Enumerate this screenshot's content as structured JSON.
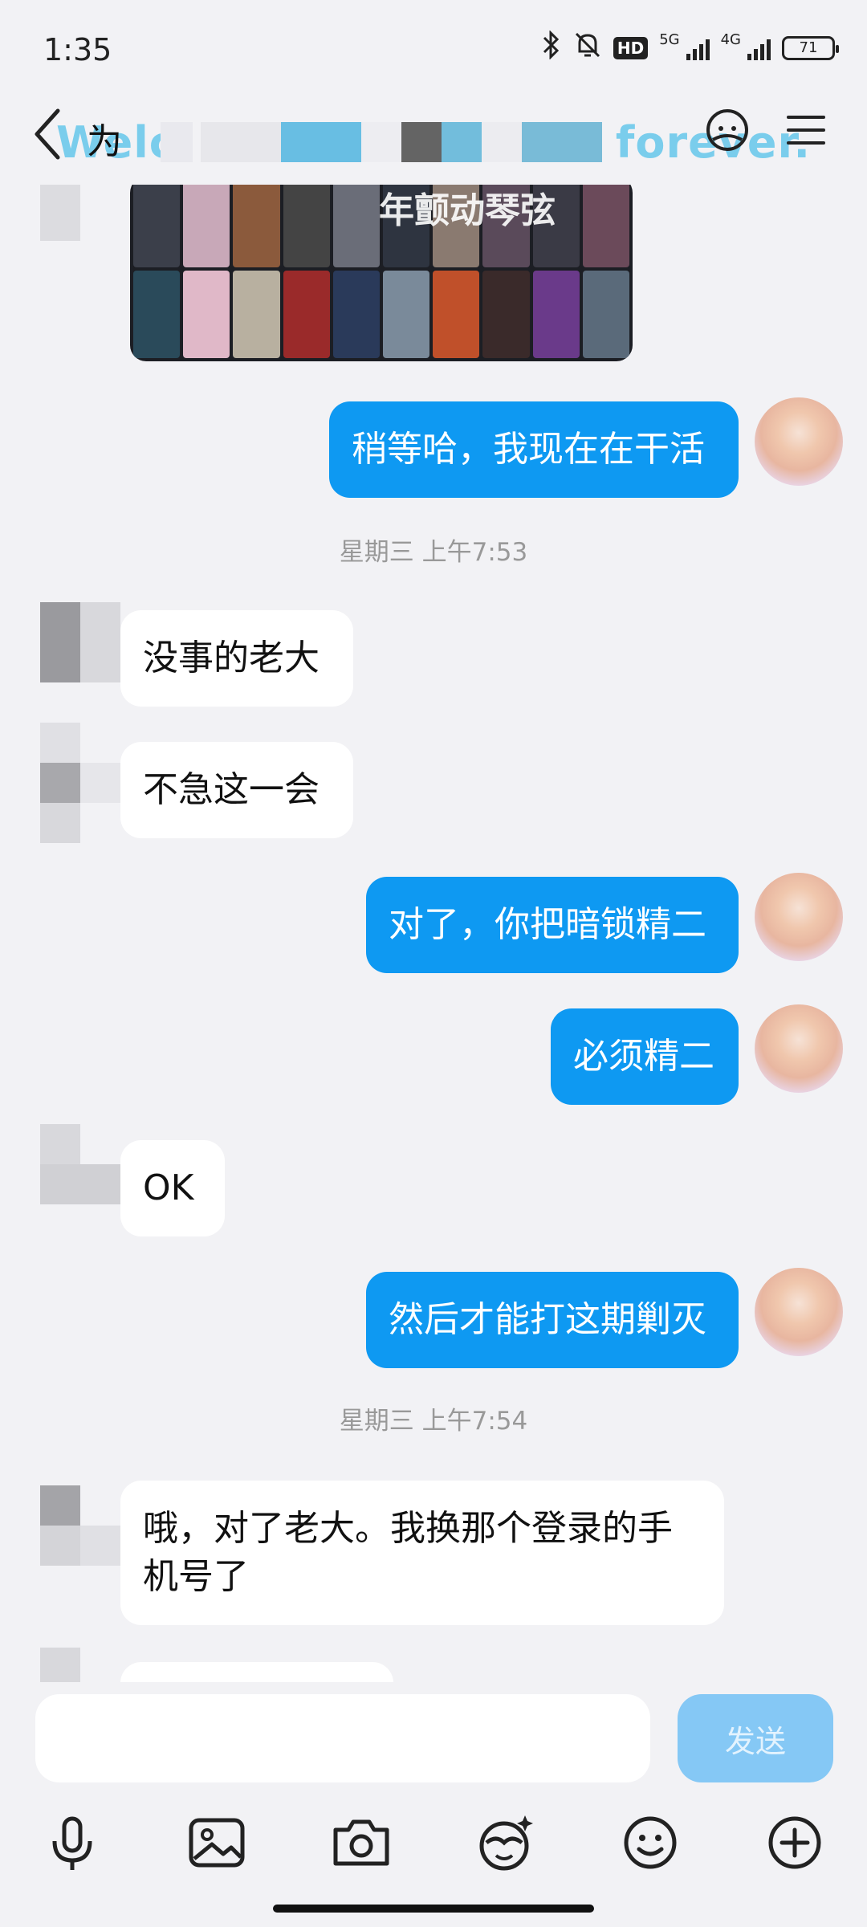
{
  "status_bar": {
    "time": "1:35",
    "hd_badge": "HD",
    "net_5g": "5G",
    "net_4g": "4G",
    "battery": "71"
  },
  "header": {
    "title": "为",
    "banner_left": "Welc",
    "banner_right": "ds time forever."
  },
  "messages": {
    "image_caption": "年颤动琴弦",
    "m1": "稍等哈，我现在在干活",
    "t1": "星期三 上午7:53",
    "m2": "没事的老大",
    "m3": "不急这一会",
    "m4": "对了，你把暗锁精二",
    "m5": "必须精二",
    "m6": "OK",
    "m7": "然后才能打这期剿灭",
    "t2": "星期三 上午7:54",
    "m8_line1": "哦，对了老大。我换那个登录的手",
    "m8_line2": "机号了"
  },
  "input": {
    "placeholder": "",
    "send_label": "发送"
  },
  "colors": {
    "my_bubble": "#0e99f2",
    "other_bubble": "#ffffff",
    "send_disabled": "#85c8f5",
    "background": "#f2f2f5"
  },
  "icons": {
    "back": "chevron-left-icon",
    "smart": "assistant-face-icon",
    "menu": "menu-icon",
    "voice": "microphone-icon",
    "gallery": "image-icon",
    "camera": "camera-icon",
    "effects": "magic-face-icon",
    "emoji": "emoji-icon",
    "more": "plus-circle-icon"
  }
}
